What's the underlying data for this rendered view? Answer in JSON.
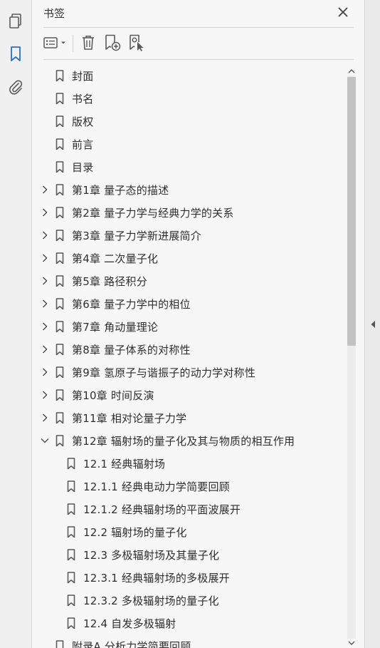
{
  "panel": {
    "title": "书签",
    "close_icon": "close-icon"
  },
  "rail": {
    "items": [
      {
        "name": "pages-icon",
        "active": false
      },
      {
        "name": "bookmark-icon",
        "active": true
      },
      {
        "name": "attachment-icon",
        "active": false
      }
    ]
  },
  "toolbar": {
    "buttons": [
      "options-menu-icon",
      "delete-icon",
      "new-bookmark-icon",
      "bookmark-from-selection-icon"
    ]
  },
  "colors": {
    "accent": "#2b6fc2",
    "icon": "#5a5a5a",
    "text": "#2e2e2e"
  },
  "bookmarks": [
    {
      "label": "封面",
      "level": 0,
      "expander": "none"
    },
    {
      "label": "书名",
      "level": 0,
      "expander": "none"
    },
    {
      "label": "版权",
      "level": 0,
      "expander": "none"
    },
    {
      "label": "前言",
      "level": 0,
      "expander": "none"
    },
    {
      "label": "目录",
      "level": 0,
      "expander": "none"
    },
    {
      "label": "第1章  量子态的描述",
      "level": 0,
      "expander": "collapsed"
    },
    {
      "label": "第2章  量子力学与经典力学的关系",
      "level": 0,
      "expander": "collapsed"
    },
    {
      "label": "第3章  量子力学新进展简介",
      "level": 0,
      "expander": "collapsed"
    },
    {
      "label": "第4章  二次量子化",
      "level": 0,
      "expander": "collapsed"
    },
    {
      "label": "第5章  路径积分",
      "level": 0,
      "expander": "collapsed"
    },
    {
      "label": "第6章  量子力学中的相位",
      "level": 0,
      "expander": "collapsed"
    },
    {
      "label": "第7章  角动量理论",
      "level": 0,
      "expander": "collapsed"
    },
    {
      "label": "第8章  量子体系的对称性",
      "level": 0,
      "expander": "collapsed"
    },
    {
      "label": "第9章  氢原子与谐振子的动力学对称性",
      "level": 0,
      "expander": "collapsed"
    },
    {
      "label": "第10章  时间反演",
      "level": 0,
      "expander": "collapsed"
    },
    {
      "label": "第11章  相对论量子力学",
      "level": 0,
      "expander": "collapsed"
    },
    {
      "label": "第12章  辐射场的量子化及其与物质的相互作用",
      "level": 0,
      "expander": "expanded"
    },
    {
      "label": "12.1  经典辐射场",
      "level": 1,
      "expander": "none"
    },
    {
      "label": "12.1.1  经典电动力学简要回顾",
      "level": 1,
      "expander": "none"
    },
    {
      "label": "12.1.2  经典辐射场的平面波展开",
      "level": 1,
      "expander": "none"
    },
    {
      "label": "12.2  辐射场的量子化",
      "level": 1,
      "expander": "none"
    },
    {
      "label": "12.3  多极辐射场及其量子化",
      "level": 1,
      "expander": "none"
    },
    {
      "label": "12.3.1  经典辐射场的多极展开",
      "level": 1,
      "expander": "none"
    },
    {
      "label": "12.3.2  多极辐射场的量子化",
      "level": 1,
      "expander": "none"
    },
    {
      "label": "12.4  自发多极辐射",
      "level": 1,
      "expander": "none"
    },
    {
      "label": "附录A  分析力学简要回顾",
      "level": 0,
      "expander": "none"
    }
  ],
  "scrollbar": {
    "position": 0.0,
    "visible_fraction": 0.48
  }
}
